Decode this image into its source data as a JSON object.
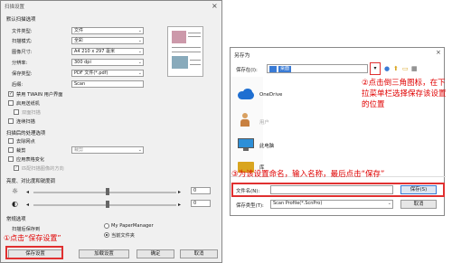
{
  "settings_window": {
    "title": "扫描设置",
    "basic_section": "默认扫描选项",
    "fields": [
      {
        "label": "文件类型:",
        "value": "文件"
      },
      {
        "label": "扫描模式:",
        "value": "全彩"
      },
      {
        "label": "图像尺寸:",
        "value": "A4 210 x 297 毫米"
      },
      {
        "label": "分辨率:",
        "value": "300 dpi"
      },
      {
        "label": "保存类型:",
        "value": "PDF 文件(*.pdf)"
      },
      {
        "label": "后缀:",
        "value": "Scan"
      }
    ],
    "checks": [
      {
        "label": "禁用 TWAIN 用户界面",
        "checked": true
      },
      {
        "label": "启用送纸机",
        "checked": false
      },
      {
        "label": "双面扫描",
        "checked": false
      },
      {
        "label": "连续扫描",
        "checked": false
      }
    ],
    "post_section": "扫描后的处理选项",
    "post_checks": [
      {
        "label": "去除网点",
        "checked": false
      },
      {
        "label": "裁剪",
        "checked": false
      },
      {
        "label": "应用表格变化",
        "checked": false
      },
      {
        "label": "匹配扫描图像的方向",
        "checked": true
      }
    ],
    "post_combo": "裁剪",
    "brightness_section": "亮度、对比度和锐度调",
    "brightness_value": "0",
    "contrast_value": "0",
    "common_section": "常规选项",
    "save_location_label": "扫描后保存到",
    "radio1": "My PaperManager",
    "radio2": "当前文件夹",
    "btn_save": "保存设置",
    "btn_load": "加载设置",
    "btn_ok": "确定",
    "btn_cancel": "取消"
  },
  "saveas_dialog": {
    "title": "另存为",
    "save_in_label": "保存在(I):",
    "save_in_value": "桌面",
    "items": [
      {
        "name": "OneDrive",
        "icon": "cloud-icon"
      },
      {
        "name": "用户",
        "icon": "user-folder-icon"
      },
      {
        "name": "此电脑",
        "icon": "computer-icon"
      },
      {
        "name": "库",
        "icon": "library-icon"
      }
    ],
    "filename_label": "文件名(N):",
    "filename_value": "",
    "filetype_label": "保存类型(T):",
    "filetype_value": "Scan Profile(*.ScnPro)",
    "btn_save": "保存(S)",
    "btn_cancel": "取消"
  },
  "annotations": {
    "a1": "①点击“保存设置”",
    "a2": "②点击倒三角图标，在下拉菜单栏选择保存该设置的位置",
    "a3": "③为该设置命名，输入名称，最后点击“保存”"
  }
}
